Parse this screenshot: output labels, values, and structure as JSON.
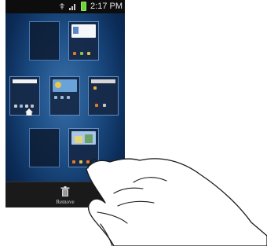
{
  "status_bar": {
    "time": "2:17 PM",
    "icons": [
      "usb-icon",
      "signal-icon",
      "battery-icon"
    ]
  },
  "home_panels": {
    "count": 7,
    "home_panel_icon": "home-icon"
  },
  "bottom_bar": {
    "remove_label": "Remove",
    "remove_icon": "trash-icon"
  },
  "colors": {
    "background": "#1d4f86",
    "panel_border": "#4a77ad",
    "status_bar": "#0d0d0d",
    "bottom_bar": "#1a1a1a"
  }
}
